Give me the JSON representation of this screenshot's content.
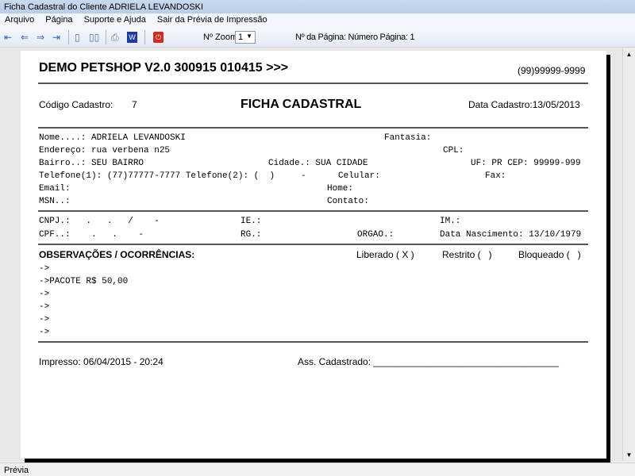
{
  "window": {
    "title": "Ficha Cadastral do Cliente ADRIELA LEVANDOSKI"
  },
  "menu": [
    "Arquivo",
    "Página",
    "Suporte e Ajuda",
    "Sair da Prévia de Impressão"
  ],
  "toolbar": {
    "zoom_label": "Nº Zoom",
    "zoom_value": "1",
    "page_label": "Nº da Página: Número Página: 1"
  },
  "status": "Prévia",
  "report": {
    "header": "DEMO PETSHOP V2.0 300915 010415 >>>",
    "phone": "(99)99999-9999",
    "codigo_label": "Código Cadastro:",
    "codigo": "7",
    "title": "FICHA CADASTRAL",
    "data_cadastro": "Data Cadastro:13/05/2013",
    "fields": {
      "nome": "Nome....: ADRIELA LEVANDOSKI",
      "fantasia": "Fantasia:",
      "endereco": "Endereço: rua verbena n25",
      "cpl": "CPL:",
      "bairro": "Bairro..: SEU BAIRRO",
      "cidade": "Cidade.: SUA CIDADE",
      "uf_cep": "UF: PR CEP: 99999-999",
      "telefones": "Telefone(1): (77)77777-7777 Telefone(2): (  )     -",
      "celular": "Celular:",
      "fax": "Fax:",
      "email": "Email:",
      "home": "Home:",
      "msn": "MSN..:",
      "contato": "Contato:",
      "cnpj": "CNPJ.:   .   .   /    -",
      "ie": "IE.:",
      "im": "IM.:",
      "cpf": "CPF..:    .   .    -",
      "rg": "RG.:",
      "orgao": "ORGAO.:",
      "nascimento": "Data Nascimento: 13/10/1979"
    },
    "obs_title": "OBSERVAÇÕES / OCORRÊNCIAS:",
    "liberado": "Liberado ( X )",
    "restrito": "Restrito (   )",
    "bloqueado": "Bloqueado (   )",
    "obs_lines": [
      "->",
      "->PACOTE R$ 50,00",
      "->",
      "->",
      "->",
      "->"
    ],
    "impresso": "Impresso: 06/04/2015 - 20:24",
    "assinatura": "Ass. Cadastrado: ___________________________________"
  }
}
